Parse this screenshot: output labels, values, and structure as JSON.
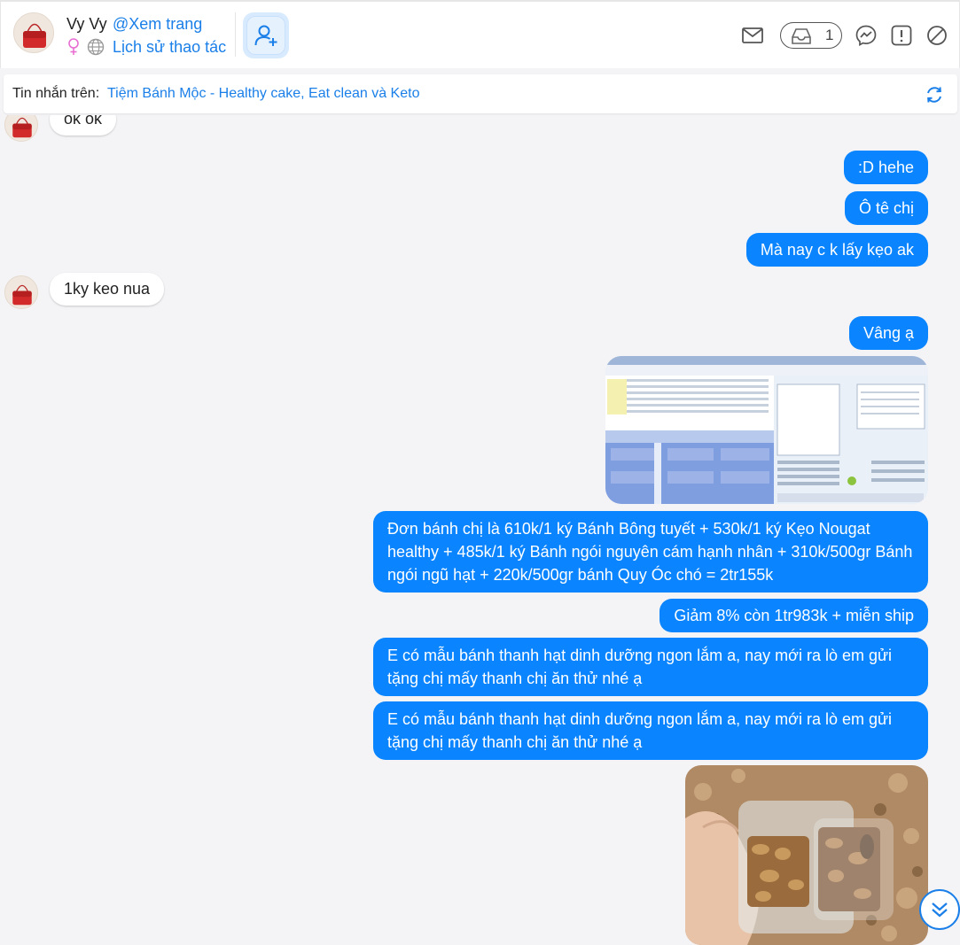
{
  "header": {
    "user_name": "Vy Vy",
    "view_page": "@Xem trang",
    "history": "Lịch sử thao tác",
    "inbox_count": "1",
    "icons": [
      "mail-icon",
      "inbox-icon",
      "messenger-icon",
      "report-icon",
      "block-icon",
      "add-friend-icon",
      "female-icon",
      "globe-icon"
    ]
  },
  "context": {
    "label": "Tin nhắn trên:",
    "page_name": "Tiệm Bánh Mộc - Healthy cake, Eat clean và Keto"
  },
  "messages": [
    {
      "dir": "in",
      "text": "ok ok"
    },
    {
      "dir": "out",
      "text": ":D hehe"
    },
    {
      "dir": "out",
      "text": "Ô tê chị"
    },
    {
      "dir": "out",
      "text": "Mà nay c k lấy kẹo ak"
    },
    {
      "dir": "in",
      "text": "1ky keo nua"
    },
    {
      "dir": "out",
      "text": "Vâng ạ"
    },
    {
      "dir": "out",
      "type": "image",
      "image": "pos-software-screenshot"
    },
    {
      "dir": "out",
      "text": "Đơn bánh chị là 610k/1 ký Bánh Bông tuyết + 530k/1 ký Kẹo Nougat healthy + 485k/1 ký Bánh ngói nguyên cám hạnh nhân + 310k/500gr Bánh ngói ngũ hạt + 220k/500gr bánh Quy Óc chó = 2tr155k"
    },
    {
      "dir": "out",
      "text": "Giảm 8% còn 1tr983k + miễn ship"
    },
    {
      "dir": "out",
      "text": "E có mẫu bánh thanh hạt dinh dưỡng ngon lắm a, nay mới ra lò em gửi tặng chị mấy thanh chị ăn thử nhé ạ"
    },
    {
      "dir": "out",
      "text": "E có mẫu bánh thanh hạt dinh dưỡng ngon lắm a, nay mới ra lò em gửi tặng chị mấy thanh chị ăn thử nhé ạ"
    },
    {
      "dir": "out",
      "type": "image",
      "image": "nut-bar-photo"
    }
  ],
  "colors": {
    "accent": "#1a7fe8",
    "bubble_out": "#0a84ff",
    "bubble_in": "#ffffff",
    "background": "#f4f4f6"
  }
}
